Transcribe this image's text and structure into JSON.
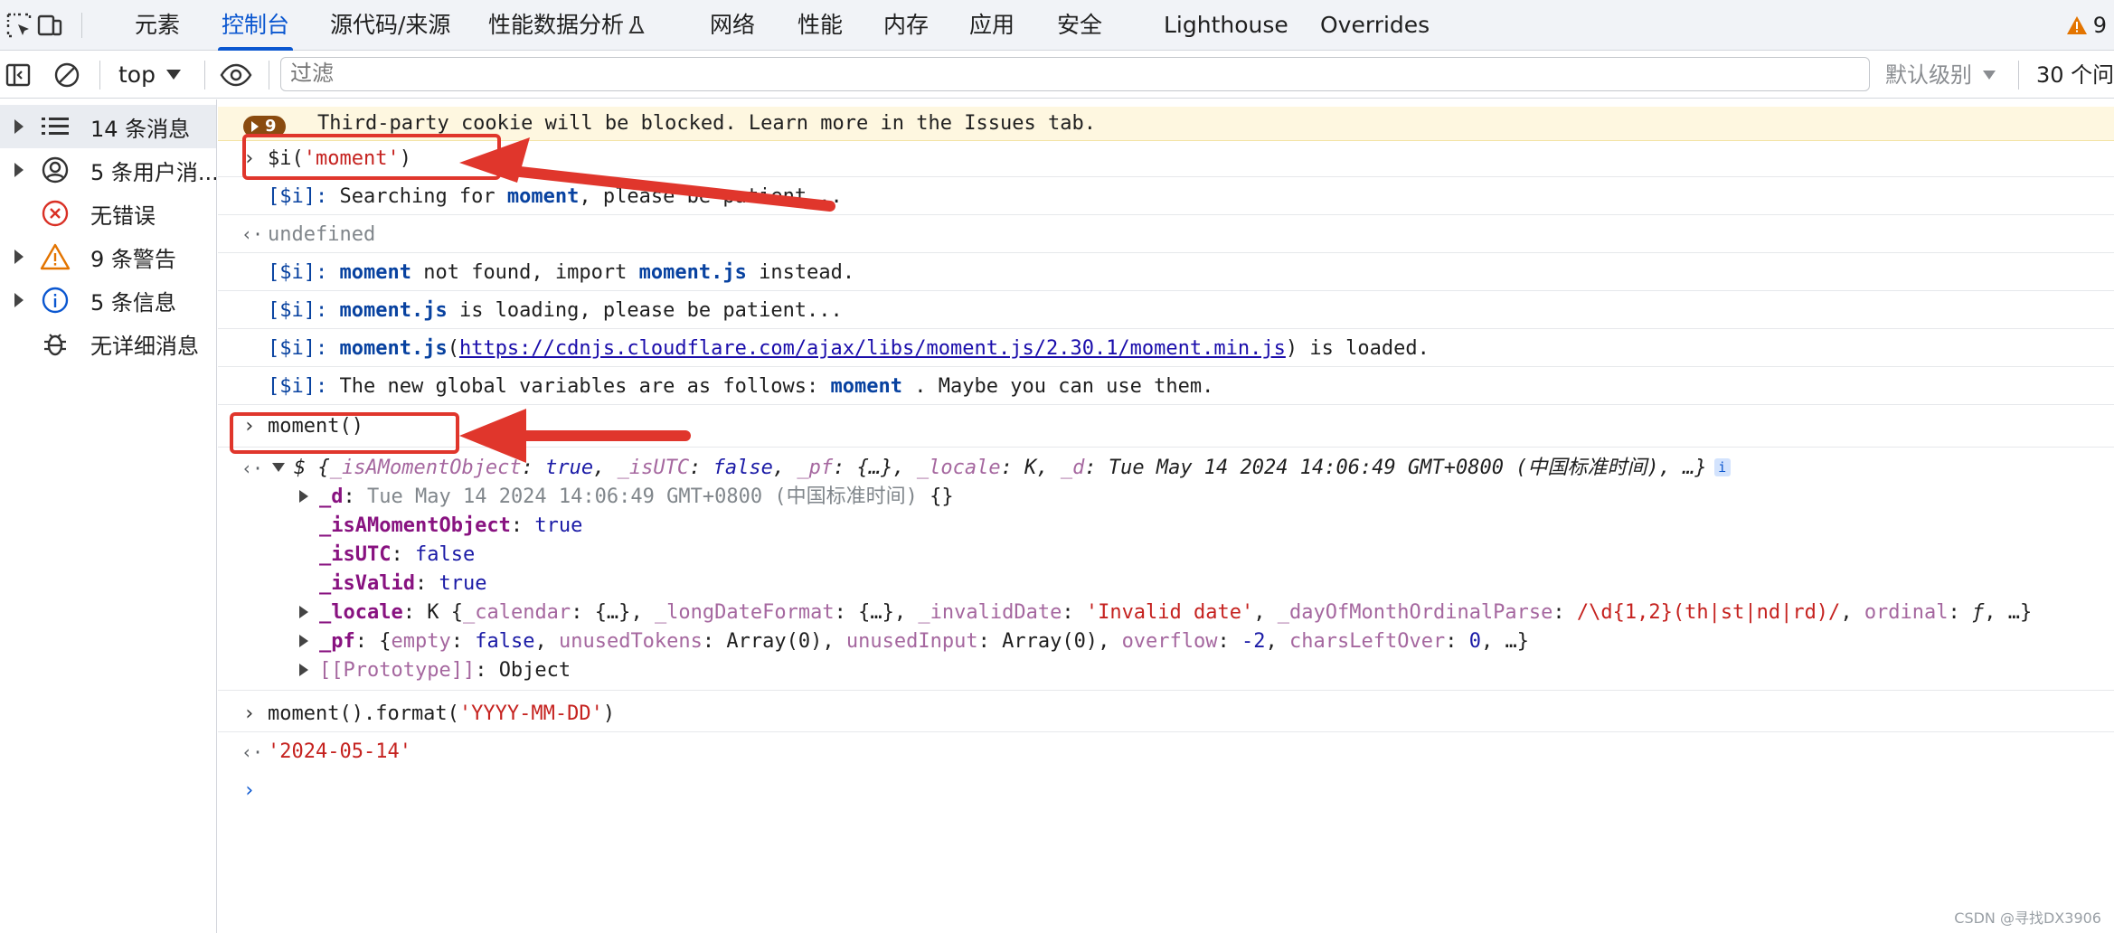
{
  "tabs": [
    {
      "label": "元素"
    },
    {
      "label": "控制台"
    },
    {
      "label": "源代码/来源"
    },
    {
      "label": "性能数据分析"
    },
    {
      "label": "网络"
    },
    {
      "label": "性能"
    },
    {
      "label": "内存"
    },
    {
      "label": "应用"
    },
    {
      "label": "安全"
    },
    {
      "label": "Lighthouse"
    },
    {
      "label": "Overrides"
    }
  ],
  "issues_count": "9",
  "toolbar": {
    "context": "top",
    "filter_placeholder": "过滤",
    "level": "默认级别",
    "issues": "30 个问"
  },
  "sidebar": {
    "items": [
      {
        "label": "14 条消息",
        "icon": "list-icon"
      },
      {
        "label": "5 条用户消...",
        "icon": "user-icon"
      },
      {
        "label": "无错误",
        "icon": "error-icon"
      },
      {
        "label": "9 条警告",
        "icon": "warning-icon"
      },
      {
        "label": "5 条信息",
        "icon": "info-icon"
      },
      {
        "label": "无详细消息",
        "icon": "bug-icon"
      }
    ]
  },
  "console": {
    "warning": {
      "count": "9",
      "text": "Third-party cookie will be blocked. Learn more in the Issues tab."
    },
    "cmd1": {
      "fn": "$i(",
      "arg": "'moment'",
      "close": ")"
    },
    "log1": {
      "prefix": "[$i]:",
      "t1": " Searching for ",
      "b1": "moment",
      "t2": ", please be patient..."
    },
    "ret1": "undefined",
    "log2": {
      "prefix": "[$i]:",
      "b1": "moment",
      "t1": " not found, import ",
      "b2": "moment.js",
      "t2": " instead."
    },
    "log3": {
      "prefix": "[$i]:",
      "b1": "moment.js",
      "t1": " is loading, please be patient..."
    },
    "log4": {
      "prefix": "[$i]:",
      "b1": "moment.js",
      "t1": "(",
      "url": "https://cdnjs.cloudflare.com/ajax/libs/moment.js/2.30.1/moment.min.js",
      "t2": ") is loaded."
    },
    "log5": {
      "prefix": "[$i]:",
      "t1": " The new global variables are as follows: ",
      "b1": "moment",
      "t2": " . Maybe you can use them."
    },
    "cmd2": "moment()",
    "obj_summary": {
      "p0": "$ {",
      "k1": "_isAMomentObject",
      "v1": "true",
      "k2": "_isUTC",
      "v2": "false",
      "k3": "_pf",
      "v3": "{…}",
      "k4": "_locale",
      "v4": "K",
      "k5": "_d",
      "v5": "Tue May 14 2024 14:06:49 GMT+0800 (中国标准时间)",
      "tail": ", …}"
    },
    "props": {
      "d_key": "_d",
      "d_val": "Tue May 14 2024 14:06:49 GMT+0800 (中国标准时间)",
      "d_tail": " {}",
      "isamo_key": "_isAMomentObject",
      "isamo_val": "true",
      "isutc_key": "_isUTC",
      "isutc_val": "false",
      "isvalid_key": "_isValid",
      "isvalid_val": "true",
      "locale_key": "_locale",
      "locale_val": {
        "a": "K {",
        "k1": "_calendar",
        "v1": "{…}",
        "k2": "_longDateFormat",
        "v2": "{…}",
        "k3": "_invalidDate",
        "v3": "'Invalid date'",
        "k4": "_dayOfMonthOrdinalParse",
        "v4": "/\\d{1,2}(th|st|nd|rd)/",
        "k5": "ordinal",
        "v5": "ƒ",
        "tail": ", …}"
      },
      "pf_key": "_pf",
      "pf_val": {
        "a": "{",
        "k1": "empty",
        "v1": "false",
        "k2": "unusedTokens",
        "v2": "Array(0)",
        "k3": "unusedInput",
        "v3": "Array(0)",
        "k4": "overflow",
        "v4": "-2",
        "k5": "charsLeftOver",
        "v5": "0",
        "tail": ", …}"
      },
      "proto_key": "[[Prototype]]",
      "proto_val": "Object"
    },
    "cmd3": {
      "fn": "moment().format(",
      "arg": "'YYYY-MM-DD'",
      "close": ")"
    },
    "ret3": "'2024-05-14'"
  },
  "watermark": "CSDN @寻找DX3906",
  "colors": {
    "accent": "#0b57d0",
    "annotation": "#e0362c",
    "warning_bg": "#fef7e0"
  }
}
